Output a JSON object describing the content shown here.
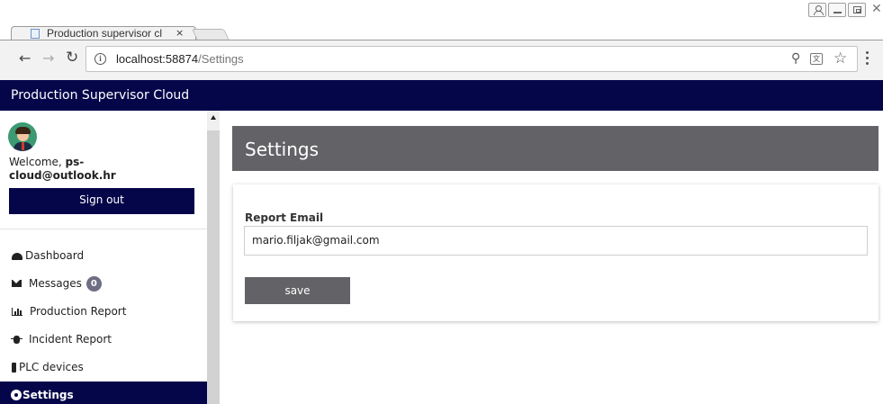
{
  "browser": {
    "tab_title": "Production supervisor cl",
    "tab_close": "×",
    "url_host": "localhost:58874",
    "url_path": "/Settings"
  },
  "app": {
    "title": "Production Supervisor Cloud"
  },
  "sidebar": {
    "welcome_prefix": "Welcome, ",
    "user_email": "ps-cloud@outlook.hr",
    "sign_out_label": "Sign out",
    "items": [
      {
        "label": "Dashboard",
        "icon": "dashboard-icon"
      },
      {
        "label": "Messages",
        "icon": "envelope-icon",
        "badge": "0"
      },
      {
        "label": "Production Report",
        "icon": "bar-chart-icon"
      },
      {
        "label": "Incident Report",
        "icon": "bug-icon"
      },
      {
        "label": "PLC devices",
        "icon": "plc-device-icon"
      },
      {
        "label": "Settings",
        "icon": "gear-icon",
        "active": true
      }
    ]
  },
  "main": {
    "title": "Settings",
    "report_email_label": "Report Email",
    "report_email_value": "mario.filjak@gmail.com",
    "save_label": "save"
  },
  "colors": {
    "brand_navy": "#05064a",
    "header_gray": "#636266",
    "badge_gray": "#6e6e83"
  }
}
